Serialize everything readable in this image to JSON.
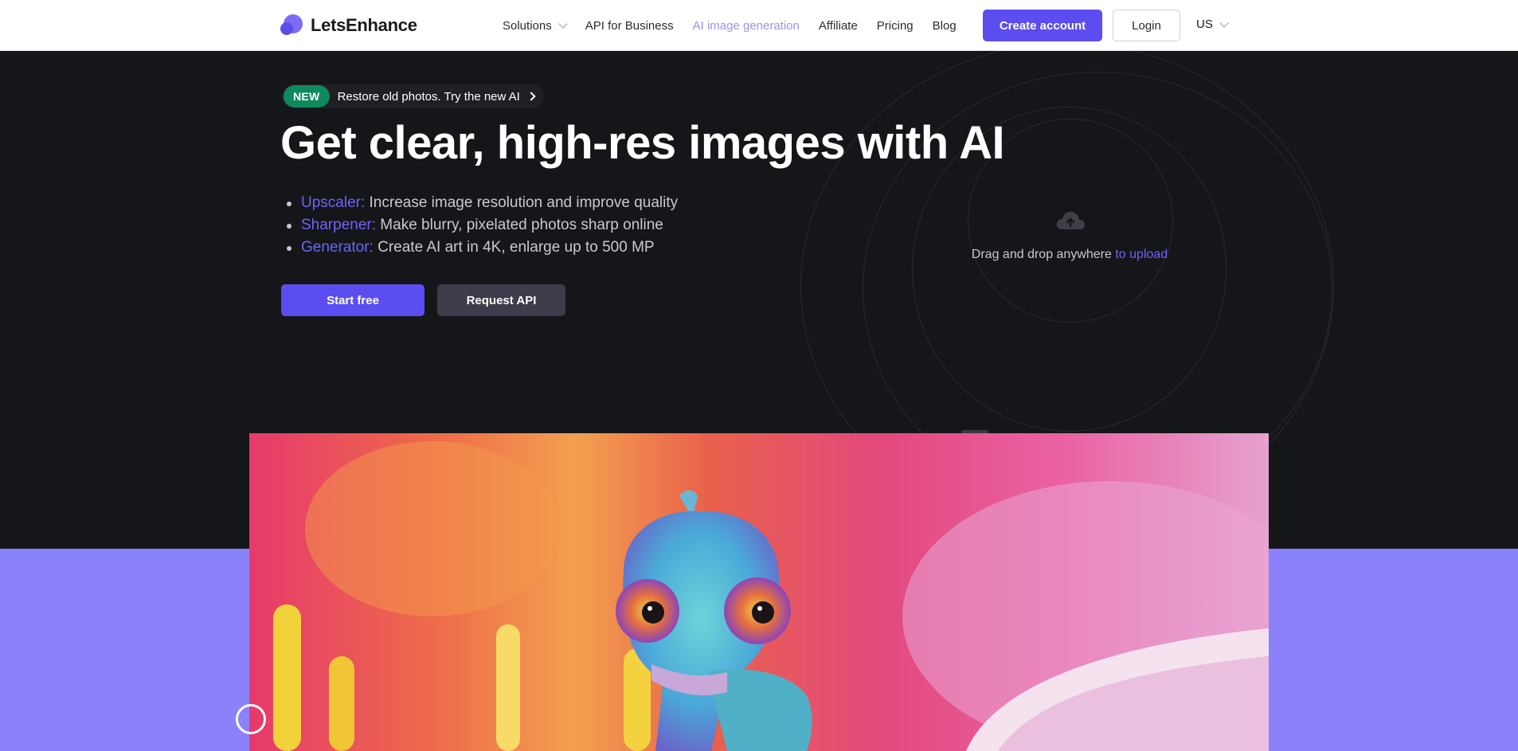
{
  "nav": {
    "logo_text": "LetsEnhance",
    "links": [
      {
        "label": "Solutions",
        "dropdown": true
      },
      {
        "label": "API for Business"
      },
      {
        "label": "AI image generation",
        "active": true
      },
      {
        "label": "Affiliate"
      },
      {
        "label": "Pricing"
      },
      {
        "label": "Blog"
      }
    ],
    "create_account": "Create account",
    "login": "Login",
    "locale": "US"
  },
  "hero": {
    "badge_new": "NEW",
    "badge_text": "Restore old photos. Try the new AI",
    "headline": "Get clear, high-res images with AI",
    "features": [
      {
        "key": "Upscaler:",
        "text": " Increase image resolution and improve quality"
      },
      {
        "key": "Sharpener:",
        "text": " Make blurry, pixelated photos sharp online"
      },
      {
        "key": "Generator:",
        "text": " Create AI art in 4K, enlarge up to 500 MP"
      }
    ],
    "start_free": "Start free",
    "request_api": "Request API",
    "upload_text": "Drag and drop anywhere ",
    "upload_link": "to upload"
  },
  "colors": {
    "accent": "#5b4df0",
    "hero_bg": "#151619",
    "lower_bg": "#8b82fb",
    "badge_green": "#0f8a5f"
  },
  "icons": [
    "chevron-down-icon",
    "chevron-right-icon",
    "cloud-upload-icon",
    "logo-mark-icon"
  ]
}
